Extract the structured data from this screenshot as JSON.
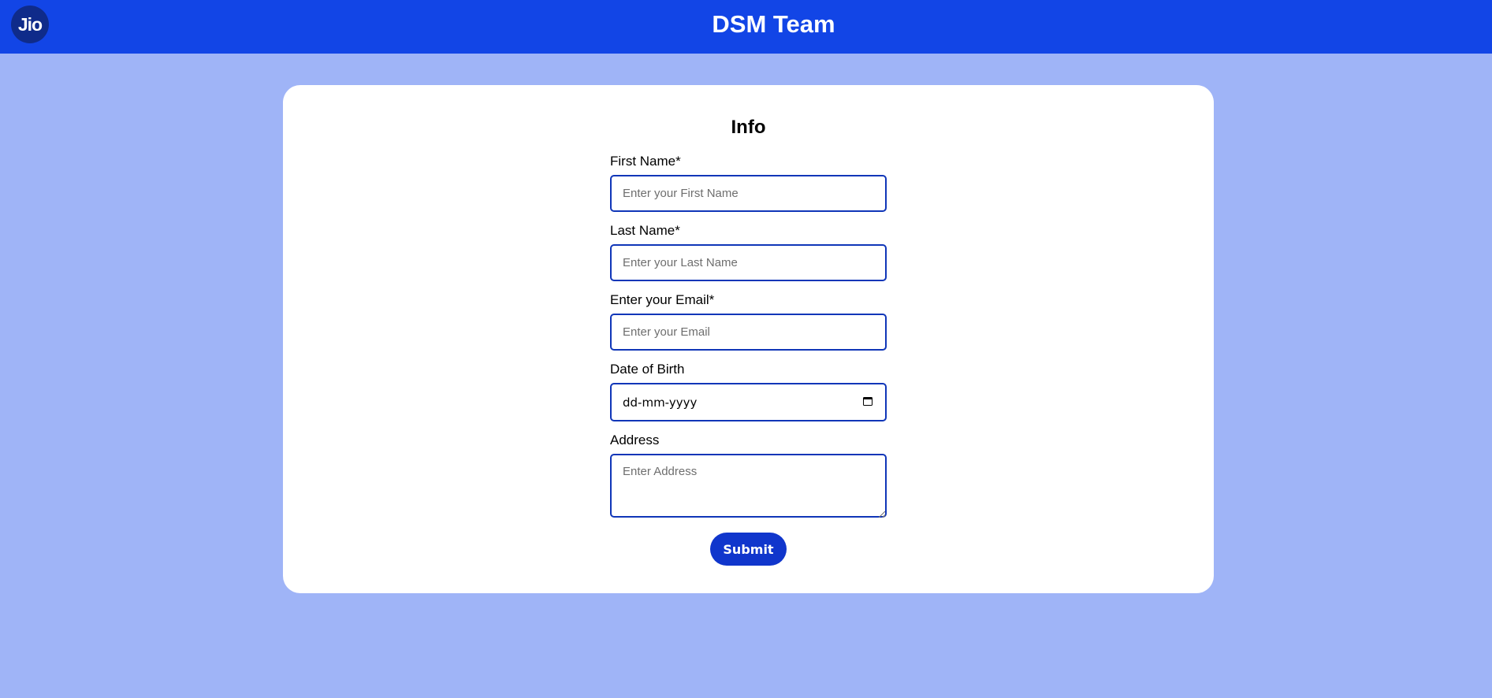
{
  "header": {
    "logo_text": "Jio",
    "title": "DSM Team",
    "background_color": "#1245e6"
  },
  "form": {
    "title": "Info",
    "fields": {
      "first_name": {
        "label": "First Name*",
        "placeholder": "Enter your First Name",
        "value": ""
      },
      "last_name": {
        "label": "Last Name*",
        "placeholder": "Enter your Last Name",
        "value": ""
      },
      "email": {
        "label": "Enter your Email*",
        "placeholder": "Enter your Email",
        "value": ""
      },
      "dob": {
        "label": "Date of Birth",
        "display_value": "dd-mm-yyyy",
        "icon": "calendar-icon"
      },
      "address": {
        "label": "Address",
        "placeholder": "Enter Address",
        "value": ""
      }
    },
    "submit_label": "Submit",
    "accent_color": "#1036cc"
  },
  "page": {
    "background_color": "#9fb4f7"
  }
}
